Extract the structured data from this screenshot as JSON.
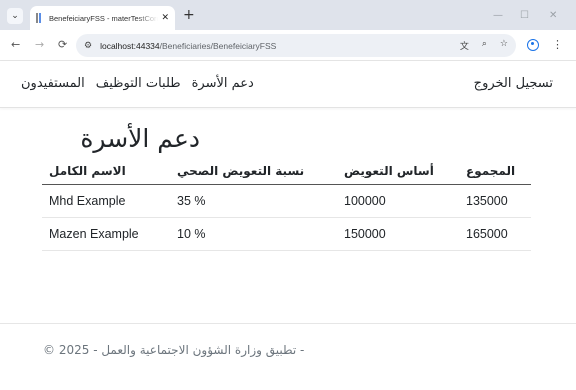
{
  "browser": {
    "tab_title": "BenefeiciaryFSS - materTestCore",
    "url_host": "localhost:44334",
    "url_path": "/Beneficiaries/BenefeiciaryFSS",
    "icons": {
      "back": "←",
      "forward": "→",
      "reload": "⟳",
      "site_info": "⚙",
      "translate": "文",
      "zoom": "⌕",
      "bookmark": "☆",
      "menu": "⋮",
      "minimize": "—",
      "maximize": "☐",
      "close": "✕",
      "new_tab": "+",
      "tab_close": "✕",
      "tab_list": "⌄"
    }
  },
  "navbar": {
    "brand": "تسجيل الخروج",
    "links": [
      "دعم الأسرة",
      "طلبات التوظيف",
      "المستفيدون"
    ]
  },
  "main": {
    "heading": "دعم الأسرة",
    "table": {
      "columns": [
        "الاسم الكامل",
        "نسبة التعويض الصحي",
        "أساس التعويض",
        "المجموع"
      ],
      "rows": [
        [
          "Mhd Example",
          "35 %",
          "100000",
          "135000"
        ],
        [
          "Mazen Example",
          "10 %",
          "150000",
          "165000"
        ]
      ]
    }
  },
  "footer": {
    "text": "- تطبيق وزارة الشؤون الاجتماعية والعمل - 2025 ©"
  }
}
